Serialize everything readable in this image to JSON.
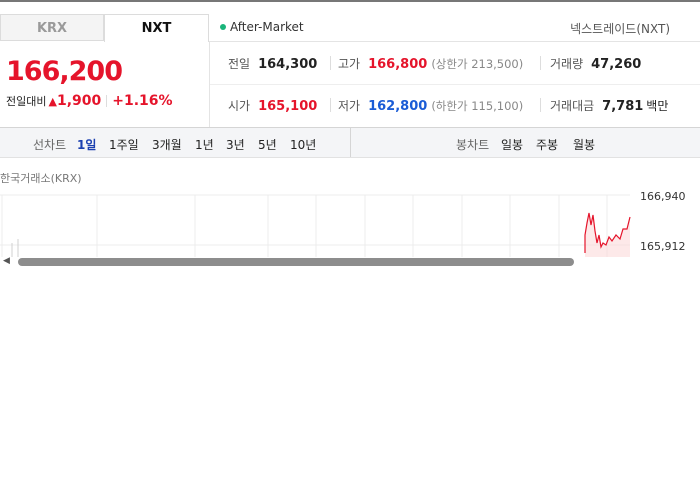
{
  "tabs": [
    {
      "label": "KRX",
      "active": false
    },
    {
      "label": "NXT",
      "active": true
    }
  ],
  "session": {
    "label": "After-Market",
    "dot_color": "#19b47a"
  },
  "market_name": "넥스트레이드(NXT)",
  "quote": {
    "price": "166,200",
    "change_label": "전일대비",
    "change_arrow": "▲",
    "change_value": "1,900",
    "change_percent": "+1.16%"
  },
  "stats": {
    "prev_close": {
      "label": "전일",
      "value": "164,300"
    },
    "high": {
      "label": "고가",
      "value": "166,800",
      "limit_text": "(상한가 213,500)"
    },
    "volume": {
      "label": "거래량",
      "value": "47,260"
    },
    "open": {
      "label": "시가",
      "value": "165,100"
    },
    "low": {
      "label": "저가",
      "value": "162,800",
      "limit_text": "(하한가 115,100)"
    },
    "amount": {
      "label": "거래대금",
      "value": "7,781",
      "unit": "백만"
    }
  },
  "toolbar": {
    "line_chart_label": "선차트",
    "periods": [
      {
        "label": "1일",
        "active": true
      },
      {
        "label": "1주일",
        "active": false
      },
      {
        "label": "3개월",
        "active": false
      },
      {
        "label": "1년",
        "active": false
      },
      {
        "label": "3년",
        "active": false
      },
      {
        "label": "5년",
        "active": false
      },
      {
        "label": "10년",
        "active": false
      }
    ],
    "candle_chart_label": "봉차트",
    "candle_periods": [
      {
        "label": "일봉"
      },
      {
        "label": "주봉"
      },
      {
        "label": "월봉"
      }
    ]
  },
  "chart": {
    "source_label": "한국거래소(KRX)",
    "y_ticks": [
      "166,940",
      "165,912"
    ],
    "line_color": "#e5142b",
    "fill_color": "#fbdada"
  },
  "colors": {
    "up": "#e5142b",
    "down": "#1a5cd6",
    "active_tab_text": "#1a3fb0"
  }
}
